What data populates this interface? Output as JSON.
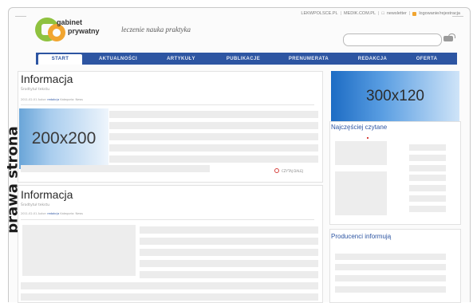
{
  "side_label": "prawa strona",
  "header": {
    "logo_word1": "gabinet",
    "logo_word2": "prywatny",
    "tagline": "leczenie nauka praktyka",
    "toplinks": [
      "LEKWPOLSCE.PL",
      "MEDIK.COM.PL",
      "newsletter",
      "logowanie/rejestracja"
    ]
  },
  "search": {
    "placeholder": ""
  },
  "nav": {
    "items": [
      "START",
      "AKTUALNOŚCI",
      "ARTYKUŁY",
      "PUBLIKACJE",
      "PRENUMERATA",
      "REDAKCJA",
      "OFERTA"
    ],
    "active": "START"
  },
  "main": {
    "articles": [
      {
        "title": "Informacja",
        "subtitle": "Środtytuł tekstu",
        "meta_date": "2011-02-01 Autor:",
        "meta_link": "redakcja",
        "meta_cat": "Kategoria: News",
        "image_label": "200x200",
        "read_more": "CZYTAJ DALEJ"
      },
      {
        "title": "Informacja",
        "subtitle": "Środtytuł tekstu",
        "meta_date": "2011-02-01 Autor:",
        "meta_link": "redakcja",
        "meta_cat": "Kategoria: News"
      }
    ]
  },
  "sidebar": {
    "banner_label": "300x120",
    "most_read_title": "Najczęściej czytane",
    "producers_title": "Producenci informują"
  },
  "colors": {
    "nav_blue": "#2d55a2",
    "logo_green": "#8fc23f",
    "logo_orange": "#f1a530",
    "accent_red": "#d7403c"
  }
}
